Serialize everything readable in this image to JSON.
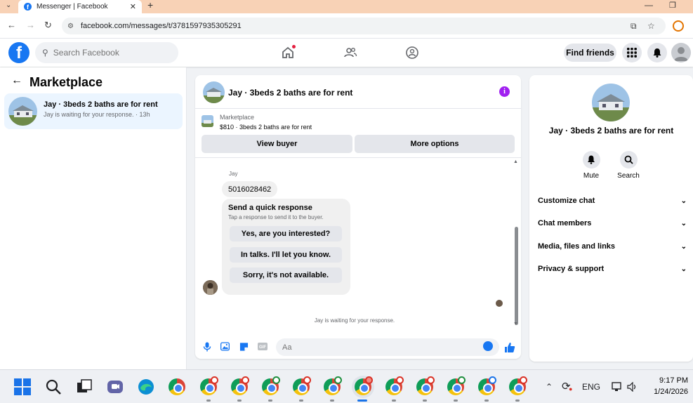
{
  "browser": {
    "tab_title": "Messenger | Facebook",
    "url": "facebook.com/messages/t/3781597935305291"
  },
  "header": {
    "search_placeholder": "Search Facebook",
    "find_friends": "Find friends"
  },
  "sidebar": {
    "title": "Marketplace",
    "conversation": {
      "name": "Jay · 3beds 2 baths are for rent",
      "subtitle": "Jay is waiting for your response. · 13h"
    }
  },
  "chat": {
    "title": "Jay · 3beds 2 baths are for rent",
    "listing": {
      "category": "Marketplace",
      "description": "$810 · 3beds 2 baths are for rent"
    },
    "view_buyer": "View buyer",
    "more_options": "More options",
    "sender": "Jay",
    "message": "5016028462",
    "quick_response": {
      "title": "Send a quick response",
      "subtitle": "Tap a response to send it to the buyer.",
      "options": [
        "Yes, are you interested?",
        "In talks. I'll let you know.",
        "Sorry, it's not available."
      ]
    },
    "waiting_note": "Jay is waiting for your response.",
    "composer_placeholder": "Aa",
    "gif_label": "GIF"
  },
  "info": {
    "title": "Jay · 3beds 2 baths are for rent",
    "actions": [
      "Mute",
      "Search"
    ],
    "sections": [
      "Customize chat",
      "Chat members",
      "Media, files and links",
      "Privacy & support"
    ]
  },
  "taskbar": {
    "language": "ENG",
    "time": "9:17 PM",
    "date": "1/24/2026"
  },
  "colors": {
    "facebook_blue": "#1877f2",
    "selected_conversation": "#ebf5ff",
    "info_icon": "#a020f0",
    "notification": "#e41e3f"
  }
}
